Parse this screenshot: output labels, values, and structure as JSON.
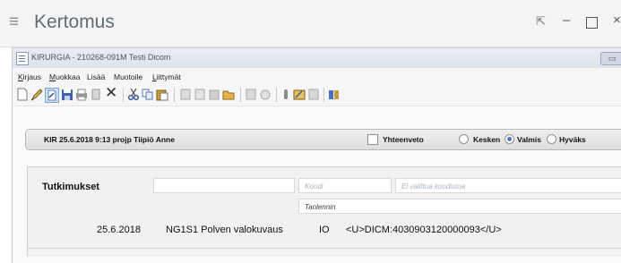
{
  "outer_window": {
    "menu_icon": "hamburger-icon",
    "title": "Kertomus",
    "controls": {
      "pin": "pin-icon",
      "minimize": "minimize-icon",
      "maximize": "maximize-icon",
      "close": "close-icon"
    }
  },
  "inner_window": {
    "title": "KIRURGIA - 210268-091M Testi Dicom",
    "minimize_symbol": "▭"
  },
  "menubar": {
    "items": [
      {
        "mnemonic": "K",
        "rest": "irjaus"
      },
      {
        "mnemonic": "M",
        "rest": "uokkaa"
      },
      {
        "mnemonic": "",
        "rest": "Lisää"
      },
      {
        "mnemonic": "",
        "rest": "Muotoile"
      },
      {
        "mnemonic": "L",
        "rest": "iittymät"
      }
    ]
  },
  "toolbar": {
    "icons": [
      "new-document-icon",
      "edit-pen-icon",
      "edit-active-icon",
      "save-icon",
      "print-icon",
      "delete-icon",
      "close-x-icon",
      "cut-icon",
      "copy-icon",
      "paste-icon",
      "template-icon",
      "insert-text-icon",
      "format-icon",
      "folder-icon",
      "spell-check-icon",
      "lock-icon",
      "info-icon",
      "sign-icon",
      "attachment-icon",
      "book-icon"
    ]
  },
  "info_strip": {
    "entry_text": "KIR  25.6.2018 9:13 projp Tiipiö Anne",
    "summary_label": "Yhteenveto",
    "status_options": [
      {
        "label": "Kesken",
        "selected": false
      },
      {
        "label": "Valmis",
        "selected": true
      },
      {
        "label": "Hyväks",
        "selected": false
      }
    ]
  },
  "content": {
    "section_title": "Tutkimukset",
    "code_placeholder": "Koodi",
    "code_select_placeholder": "Ei valittua koodistoa",
    "author_value": "Tanlennin",
    "row": {
      "date": "25.6.2018",
      "code_desc": "NG1S1 Polven valokuvaus",
      "type": "IO",
      "reference": "<U>DICM:4030903120000093</U>"
    }
  },
  "colors": {
    "accent_blue": "#4f78c3",
    "title_gray": "#5f6b76"
  }
}
